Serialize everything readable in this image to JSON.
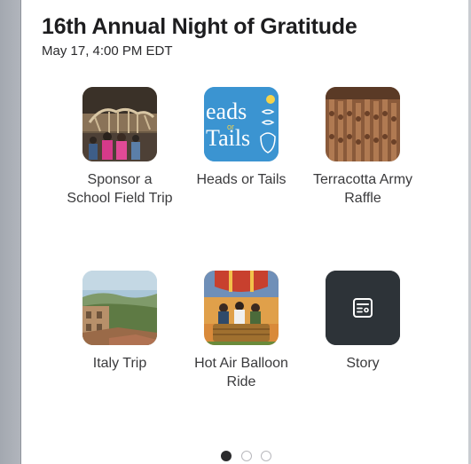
{
  "header": {
    "title": "16th Annual Night of Gratitude",
    "subtitle": "May 17, 4:00 PM EDT"
  },
  "apps": [
    {
      "label": "Sponsor a School Field Trip",
      "icon": "dinosaur-museum-photo"
    },
    {
      "label": "Heads or Tails",
      "icon": "heads-or-tails-logo",
      "icon_text": "eads",
      "icon_text_small": "or",
      "icon_text_2": "Tails"
    },
    {
      "label": "Terracotta Army Raffle",
      "icon": "terracotta-army-photo"
    },
    {
      "label": "Italy Trip",
      "icon": "italy-village-photo"
    },
    {
      "label": "Hot Air Balloon Ride",
      "icon": "hot-air-balloon-photo"
    },
    {
      "label": "Story",
      "icon": "story-icon"
    }
  ],
  "pagination": {
    "pages": 3,
    "current": 1
  },
  "colors": {
    "story_bg": "#2d3338",
    "heads_tails_bg": "#3b94d1",
    "dot_active": "#2b2b2d"
  }
}
